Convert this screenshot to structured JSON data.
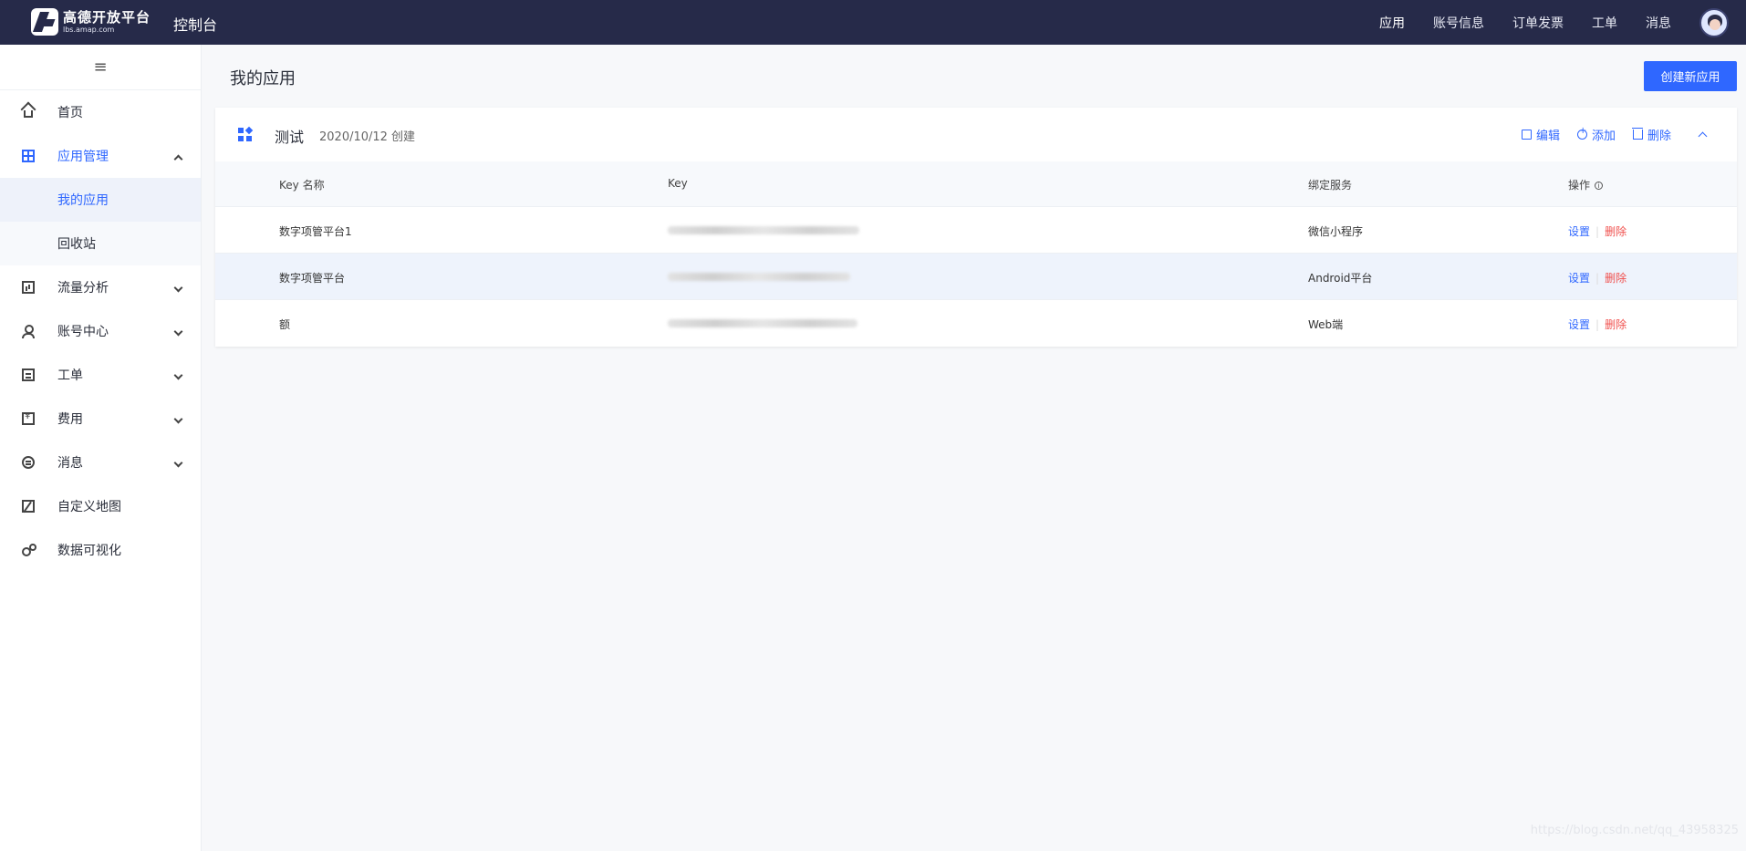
{
  "header": {
    "logo_title": "高德开放平台",
    "logo_sub": "lbs.amap.com",
    "console": "控制台",
    "nav": [
      "应用",
      "账号信息",
      "订单发票",
      "工单",
      "消息"
    ]
  },
  "sidebar": {
    "collapse_icon": "≡",
    "items": [
      {
        "label": "首页",
        "icon": "home-icon"
      },
      {
        "label": "应用管理",
        "icon": "grid-icon",
        "expanded": true,
        "children": [
          {
            "label": "我的应用",
            "selected": true
          },
          {
            "label": "回收站"
          }
        ]
      },
      {
        "label": "流量分析",
        "icon": "chart-icon"
      },
      {
        "label": "账号中心",
        "icon": "user-icon"
      },
      {
        "label": "工单",
        "icon": "document-icon"
      },
      {
        "label": "费用",
        "icon": "money-icon"
      },
      {
        "label": "消息",
        "icon": "message-icon"
      },
      {
        "label": "自定义地图",
        "icon": "map-icon"
      },
      {
        "label": "数据可视化",
        "icon": "visualization-icon"
      }
    ]
  },
  "main": {
    "title": "我的应用",
    "create_button": "创建新应用",
    "app": {
      "name": "测试",
      "created": "2020/10/12 创建",
      "actions": {
        "edit": "编辑",
        "add": "添加",
        "delete": "删除"
      },
      "columns": [
        "Key 名称",
        "Key",
        "绑定服务",
        "操作"
      ],
      "rows": [
        {
          "name": "数字项管平台1",
          "service": "微信小程序",
          "set": "设置",
          "del": "删除"
        },
        {
          "name": "数字项管平台",
          "service": "Android平台",
          "set": "设置",
          "del": "删除"
        },
        {
          "name": "额",
          "service": "Web端",
          "set": "设置",
          "del": "删除"
        }
      ]
    }
  },
  "watermark": "https://blog.csdn.net/qq_43958325",
  "colors": {
    "primary": "#2f67ff",
    "header_bg": "#262a49",
    "danger": "#f0504d"
  }
}
